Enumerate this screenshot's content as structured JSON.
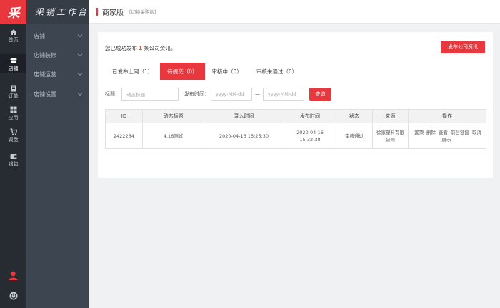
{
  "logo": "采",
  "rail": [
    {
      "label": "首页",
      "icon": "home-icon",
      "active": false
    },
    {
      "label": "店铺",
      "icon": "store-icon",
      "active": true
    },
    {
      "label": "订单",
      "icon": "order-icon",
      "active": false
    },
    {
      "label": "应用",
      "icon": "apps-icon",
      "active": false
    },
    {
      "label": "调盘",
      "icon": "cart-icon",
      "active": false
    },
    {
      "label": "钱包",
      "icon": "wallet-icon",
      "active": false
    }
  ],
  "submenu": {
    "header": "采销工作台",
    "items": [
      {
        "label": "店铺"
      },
      {
        "label": "店铺装修"
      },
      {
        "label": "店铺运营"
      },
      {
        "label": "店铺设置"
      }
    ]
  },
  "topbar": {
    "title": "商家版",
    "switch_label": "[切换采购版]"
  },
  "notice": {
    "prefix": "您已成功发布",
    "count": "1",
    "suffix": "条公司资讯。"
  },
  "publish_button": "发布公司资讯",
  "tabs": [
    {
      "label": "已发布上网（1）",
      "active": false
    },
    {
      "label": "待提交（0）",
      "active": true
    },
    {
      "label": "审核中（0）",
      "active": false
    },
    {
      "label": "审核未通过（0）",
      "active": false
    }
  ],
  "filters": {
    "title_label": "标题：",
    "title_placeholder": "动态标题",
    "date_label": "发布时间：",
    "date_from_placeholder": "yyyy-MM-dd",
    "separator": "—",
    "date_to_placeholder": "yyyy-MM-dd",
    "query_button": "查询"
  },
  "table": {
    "headers": [
      "ID",
      "动态标题",
      "录入时间",
      "发布时间",
      "状态",
      "来源",
      "操作"
    ],
    "rows": [
      {
        "id": "2422234",
        "title": "4.16测试",
        "entry_time": "2020-04-16 15:25:30",
        "publish_time": "2020-04-16 15:32:38",
        "status": "审核通过",
        "source": "徐家塑料有限公司",
        "actions": [
          "置顶",
          "删除",
          "查看",
          "前台链接",
          "取消展示"
        ]
      }
    ]
  },
  "colors": {
    "accent": "#e8383d",
    "rail_bg": "#272c33",
    "submenu_bg": "#3c4550"
  }
}
